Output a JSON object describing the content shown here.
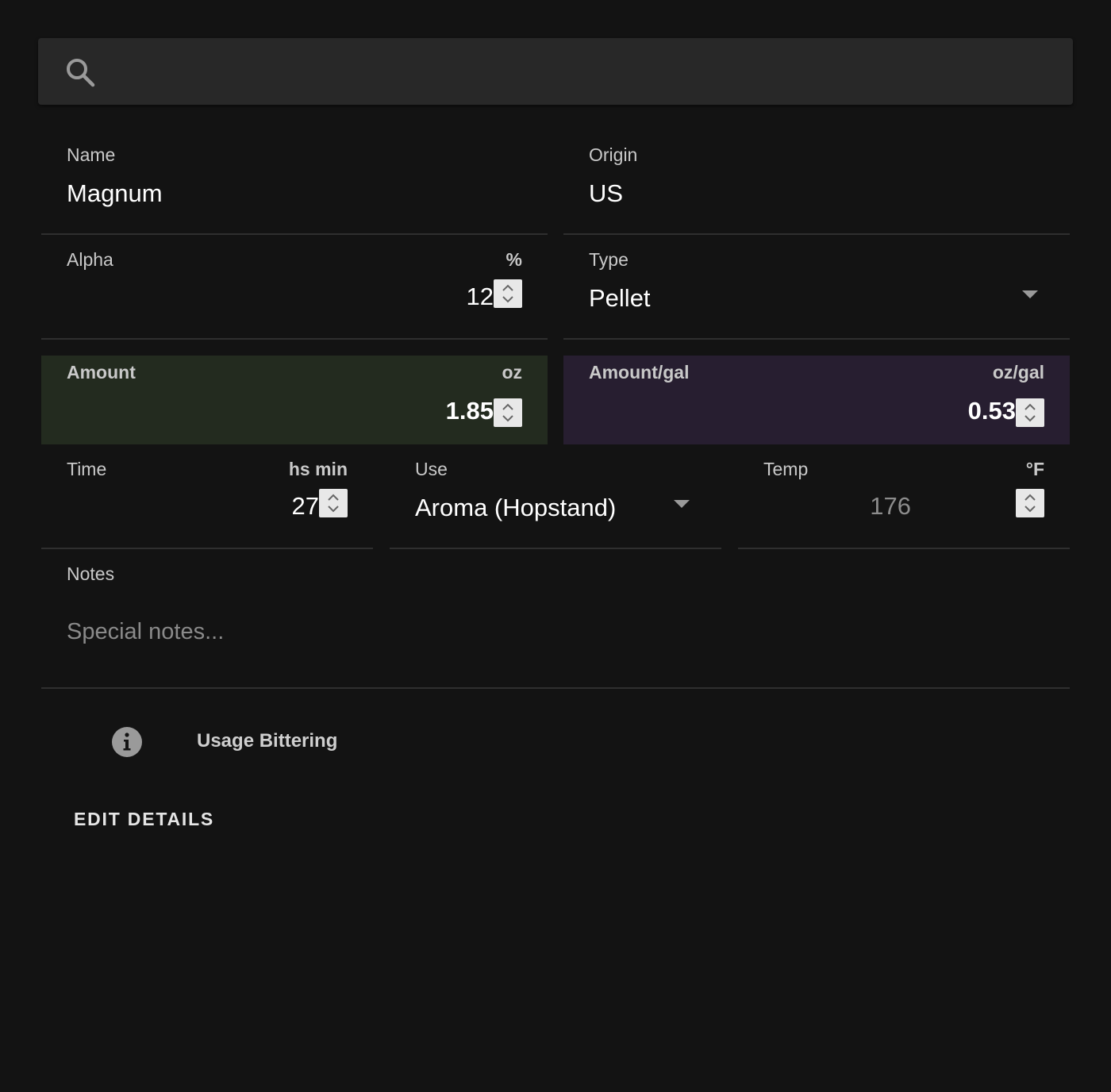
{
  "search": {
    "placeholder": "",
    "icon": "search-icon"
  },
  "fields": {
    "name": {
      "label": "Name",
      "value": "Magnum"
    },
    "origin": {
      "label": "Origin",
      "value": "US"
    },
    "alpha": {
      "label": "Alpha",
      "unit": "%",
      "value": "12"
    },
    "type": {
      "label": "Type",
      "value": "Pellet"
    },
    "amount": {
      "label": "Amount",
      "unit": "oz",
      "value": "1.85",
      "color": "#232b1f"
    },
    "amount_per_gal": {
      "label": "Amount/gal",
      "unit": "oz/gal",
      "value": "0.53",
      "color": "#271e30"
    },
    "time": {
      "label": "Time",
      "unit": "hs min",
      "value": "27"
    },
    "use": {
      "label": "Use",
      "value": "Aroma (Hopstand)"
    },
    "temp": {
      "label": "Temp",
      "unit": "°F",
      "value": "176"
    },
    "notes": {
      "label": "Notes",
      "placeholder": "Special notes..."
    }
  },
  "info": {
    "icon": "info-icon",
    "text": "Usage Bittering"
  },
  "actions": {
    "edit_label": "EDIT DETAILS"
  },
  "colors": {
    "background": "#131313",
    "search_bg": "#282828",
    "divider": "#2f2f2f"
  }
}
